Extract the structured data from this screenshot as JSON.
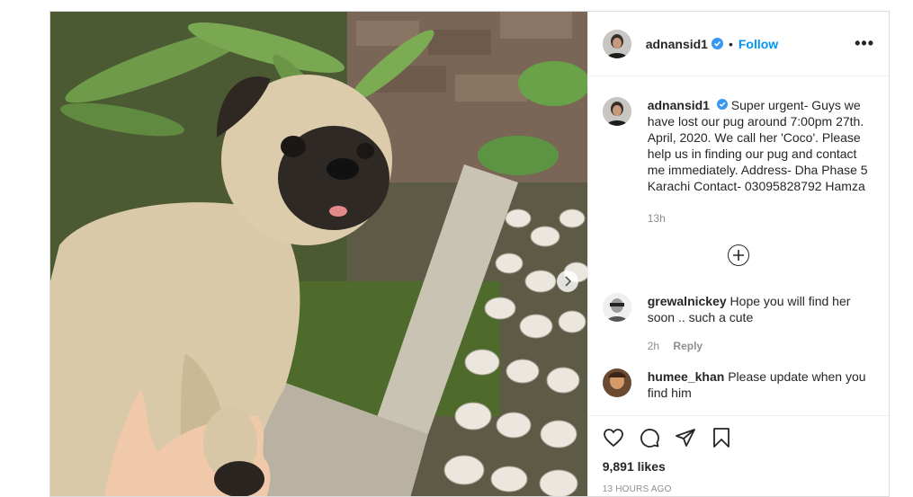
{
  "post": {
    "username": "adnansid1",
    "follow_label": "Follow",
    "separator": "•",
    "more_label": "•••",
    "caption": {
      "username": "adnansid1",
      "text": "Super urgent- Guys we have lost our pug around 7:00pm 27th. April, 2020. We call her 'Coco'. Please help us in finding our pug and contact me immediately. Address- Dha Phase 5 Karachi Contact- 03095828792 Hamza",
      "time": "13h"
    },
    "load_more_icon": "plus-circle-icon",
    "comments": [
      {
        "username": "grewalnickey",
        "text": "Hope you will find her soon .. such a cute",
        "time": "2h",
        "reply_label": "Reply"
      },
      {
        "username": "humee_khan",
        "text": "Please update when you find him",
        "time": "",
        "reply_label": ""
      }
    ],
    "likes": "9,891 likes",
    "timestamp": "13 HOURS AGO",
    "colors": {
      "link": "#0095f6",
      "verified": "#3897f0",
      "muted": "#8e8e8e",
      "text": "#262626"
    }
  }
}
